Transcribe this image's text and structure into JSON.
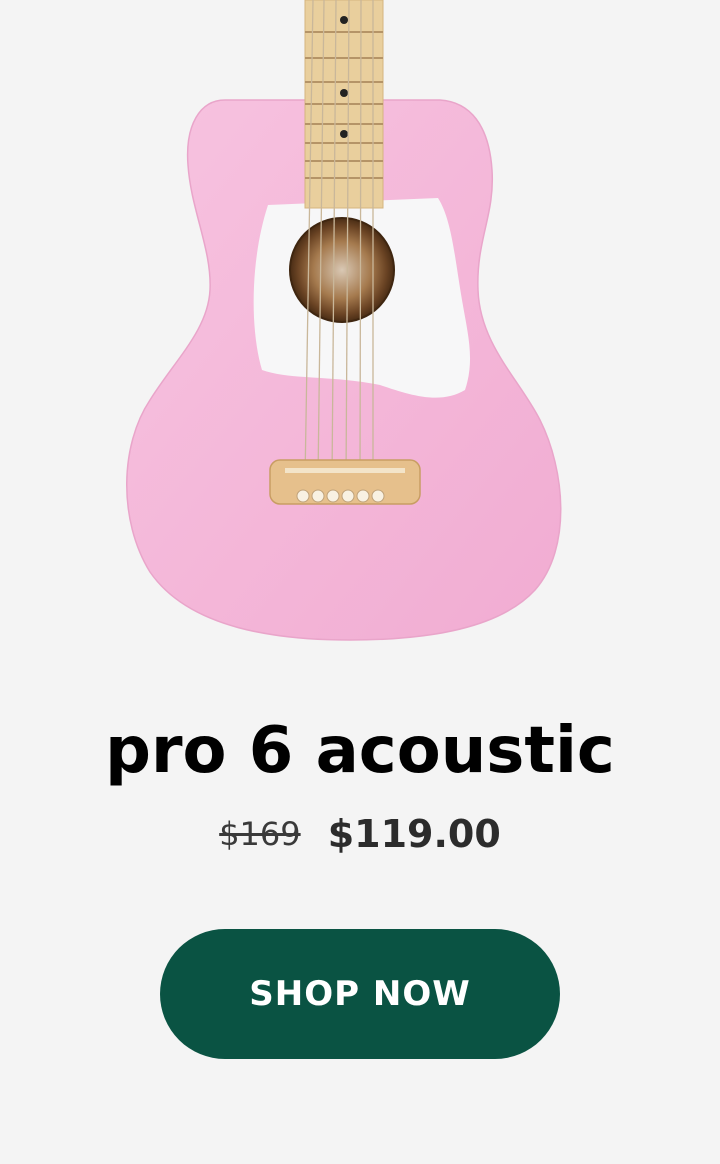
{
  "product": {
    "title": "pro 6 acoustic",
    "original_price": "$169",
    "sale_price": "$119.00",
    "image_icon": "pink-acoustic-guitar-icon",
    "body_color": "#f4b6d8"
  },
  "cta": {
    "label": "SHOP NOW",
    "color": "#0a5343"
  }
}
